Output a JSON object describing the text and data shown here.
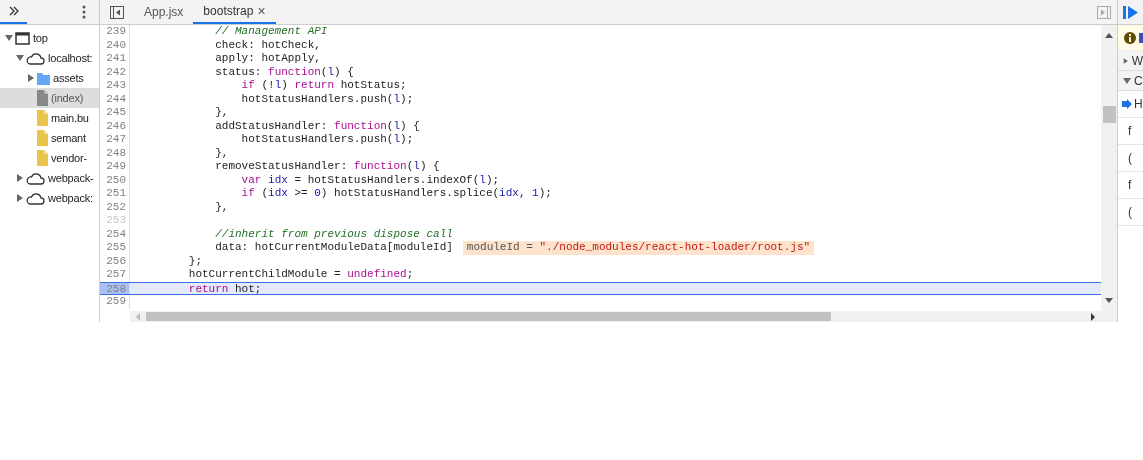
{
  "navigator": {
    "tree": [
      {
        "kind": "frame",
        "label": "top",
        "expanded": true,
        "selected": false,
        "children": [
          {
            "kind": "origin",
            "label": "localhost:",
            "expanded": true,
            "selected": false,
            "children": [
              {
                "kind": "folder",
                "label": "assets",
                "expanded": false,
                "selected": false
              },
              {
                "kind": "document",
                "label": "(index)",
                "selected": true
              },
              {
                "kind": "script",
                "label": "main.bu",
                "selected": false
              },
              {
                "kind": "script",
                "label": "semant",
                "selected": false
              },
              {
                "kind": "script",
                "label": "vendor-",
                "selected": false
              }
            ]
          },
          {
            "kind": "origin",
            "label": "webpack-",
            "expanded": false,
            "selected": false
          },
          {
            "kind": "origin",
            "label": "webpack:",
            "expanded": false,
            "selected": false
          }
        ]
      }
    ]
  },
  "editor": {
    "tabs": [
      {
        "label": "App.jsx",
        "selected": false,
        "closable": false
      },
      {
        "label": "bootstrap",
        "selected": true,
        "closable": true,
        "close_glyph": "×"
      }
    ],
    "lines": [
      {
        "number": "239",
        "tokens": [
          {
            "kind": "comment",
            "text": "            // Management API"
          }
        ]
      },
      {
        "number": "240",
        "tokens": [
          {
            "kind": "plain",
            "text": "            check: hotCheck,"
          }
        ]
      },
      {
        "number": "241",
        "tokens": [
          {
            "kind": "plain",
            "text": "            apply: hotApply,"
          }
        ]
      },
      {
        "number": "242",
        "tokens": [
          {
            "kind": "plain",
            "text": "            status: "
          },
          {
            "kind": "keyword",
            "text": "function"
          },
          {
            "kind": "plain",
            "text": "("
          },
          {
            "kind": "variable",
            "text": "l"
          },
          {
            "kind": "plain",
            "text": ") {"
          }
        ]
      },
      {
        "number": "243",
        "tokens": [
          {
            "kind": "keyword",
            "text": "                if"
          },
          {
            "kind": "plain",
            "text": " (!"
          },
          {
            "kind": "variable",
            "text": "l"
          },
          {
            "kind": "plain",
            "text": ") "
          },
          {
            "kind": "keyword",
            "text": "return"
          },
          {
            "kind": "plain",
            "text": " hotStatus;"
          }
        ]
      },
      {
        "number": "244",
        "tokens": [
          {
            "kind": "plain",
            "text": "                hotStatusHandlers.push("
          },
          {
            "kind": "variable",
            "text": "l"
          },
          {
            "kind": "plain",
            "text": ");"
          }
        ]
      },
      {
        "number": "245",
        "tokens": [
          {
            "kind": "plain",
            "text": "            },"
          }
        ]
      },
      {
        "number": "246",
        "tokens": [
          {
            "kind": "plain",
            "text": "            addStatusHandler: "
          },
          {
            "kind": "keyword",
            "text": "function"
          },
          {
            "kind": "plain",
            "text": "("
          },
          {
            "kind": "variable",
            "text": "l"
          },
          {
            "kind": "plain",
            "text": ") {"
          }
        ]
      },
      {
        "number": "247",
        "tokens": [
          {
            "kind": "plain",
            "text": "                hotStatusHandlers.push("
          },
          {
            "kind": "variable",
            "text": "l"
          },
          {
            "kind": "plain",
            "text": ");"
          }
        ]
      },
      {
        "number": "248",
        "tokens": [
          {
            "kind": "plain",
            "text": "            },"
          }
        ]
      },
      {
        "number": "249",
        "tokens": [
          {
            "kind": "plain",
            "text": "            removeStatusHandler: "
          },
          {
            "kind": "keyword",
            "text": "function"
          },
          {
            "kind": "plain",
            "text": "("
          },
          {
            "kind": "variable",
            "text": "l"
          },
          {
            "kind": "plain",
            "text": ") {"
          }
        ]
      },
      {
        "number": "250",
        "tokens": [
          {
            "kind": "keyword",
            "text": "                var "
          },
          {
            "kind": "variable",
            "text": "idx"
          },
          {
            "kind": "plain",
            "text": " = hotStatusHandlers.indexOf("
          },
          {
            "kind": "variable",
            "text": "l"
          },
          {
            "kind": "plain",
            "text": ");"
          }
        ]
      },
      {
        "number": "251",
        "tokens": [
          {
            "kind": "keyword",
            "text": "                if"
          },
          {
            "kind": "plain",
            "text": " ("
          },
          {
            "kind": "variable",
            "text": "idx"
          },
          {
            "kind": "plain",
            "text": " >= "
          },
          {
            "kind": "number",
            "text": "0"
          },
          {
            "kind": "plain",
            "text": ") hotStatusHandlers.splice("
          },
          {
            "kind": "variable",
            "text": "idx"
          },
          {
            "kind": "plain",
            "text": ", "
          },
          {
            "kind": "number",
            "text": "1"
          },
          {
            "kind": "plain",
            "text": ");"
          }
        ]
      },
      {
        "number": "252",
        "tokens": [
          {
            "kind": "plain",
            "text": "            },"
          }
        ]
      },
      {
        "number": "253",
        "dim": true
      },
      {
        "number": "254",
        "tokens": [
          {
            "kind": "comment",
            "text": "            //inherit from previous dispose call"
          }
        ]
      },
      {
        "number": "255",
        "tokens": [
          {
            "kind": "plain",
            "text": "            data: hotCurrentModuleData[moduleId]"
          }
        ],
        "inline_value": {
          "name": "moduleId = ",
          "value": "\"./node_modules/react-hot-loader/root.js\""
        }
      },
      {
        "number": "256",
        "tokens": [
          {
            "kind": "plain",
            "text": "        };"
          }
        ]
      },
      {
        "number": "257",
        "tokens": [
          {
            "kind": "plain",
            "text": "        hotCurrentChildModule = "
          },
          {
            "kind": "keyword",
            "text": "undefined"
          },
          {
            "kind": "plain",
            "text": ";"
          }
        ]
      },
      {
        "number": "258",
        "current": true,
        "tokens": [
          {
            "kind": "keyword",
            "text": "        return"
          },
          {
            "kind": "plain",
            "text": " hot;"
          }
        ]
      },
      {
        "number": "259"
      }
    ]
  },
  "debugger": {
    "sections": [
      {
        "label": "W",
        "expanded": false
      },
      {
        "label": "C",
        "expanded": true
      }
    ],
    "frames": [
      {
        "label": "H",
        "current": true
      },
      {
        "label": "f",
        "current": false
      },
      {
        "label": "(",
        "current": false
      },
      {
        "label": "f",
        "current": false
      },
      {
        "label": "(",
        "current": false
      }
    ]
  }
}
